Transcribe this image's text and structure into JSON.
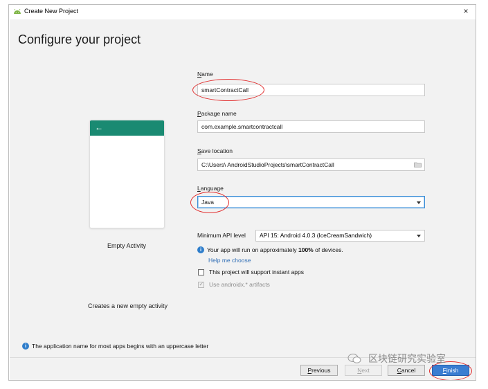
{
  "window": {
    "title": "Create New Project",
    "close_label": "×"
  },
  "page": {
    "title": "Configure your project"
  },
  "template": {
    "name": "Empty Activity",
    "description": "Creates a new empty activity",
    "back_arrow": "←"
  },
  "form": {
    "name_label_key": "N",
    "name_label_rest": "ame",
    "name_value": "smartContractCall",
    "package_label_key": "P",
    "package_label_rest": "ackage name",
    "package_value": "com.example.smartcontractcall",
    "save_label_key": "S",
    "save_label_rest": "ave location",
    "save_value": "C:\\Users\\   AndroidStudioProjects\\smartContractCall",
    "language_label_key": "L",
    "language_label_rest": "anguage",
    "language_value": "Java",
    "min_api_label": "Minimum API level",
    "min_api_value": "API 15: Android 4.0.3 (IceCreamSandwich)",
    "coverage_prefix": "Your app will run on approximately ",
    "coverage_percent": "100%",
    "coverage_suffix": " of devices.",
    "help_link": "Help me choose",
    "instant_apps_label": "This project will support instant apps",
    "androidx_label": "Use androidx.* artifacts"
  },
  "hint": {
    "text": "The application name for most apps begins with an uppercase letter"
  },
  "buttons": {
    "previous_key": "P",
    "previous_rest": "revious",
    "next_key": "N",
    "next_rest": "ext",
    "cancel_key": "C",
    "cancel_rest": "ancel",
    "finish_key": "F",
    "finish_rest": "inish"
  },
  "watermark": {
    "text": "区块链研究实验室"
  },
  "colors": {
    "accent": "#3a7dd1",
    "phone_bar": "#1a8a72",
    "info": "#2f7ecb",
    "annotation": "#e23030"
  }
}
